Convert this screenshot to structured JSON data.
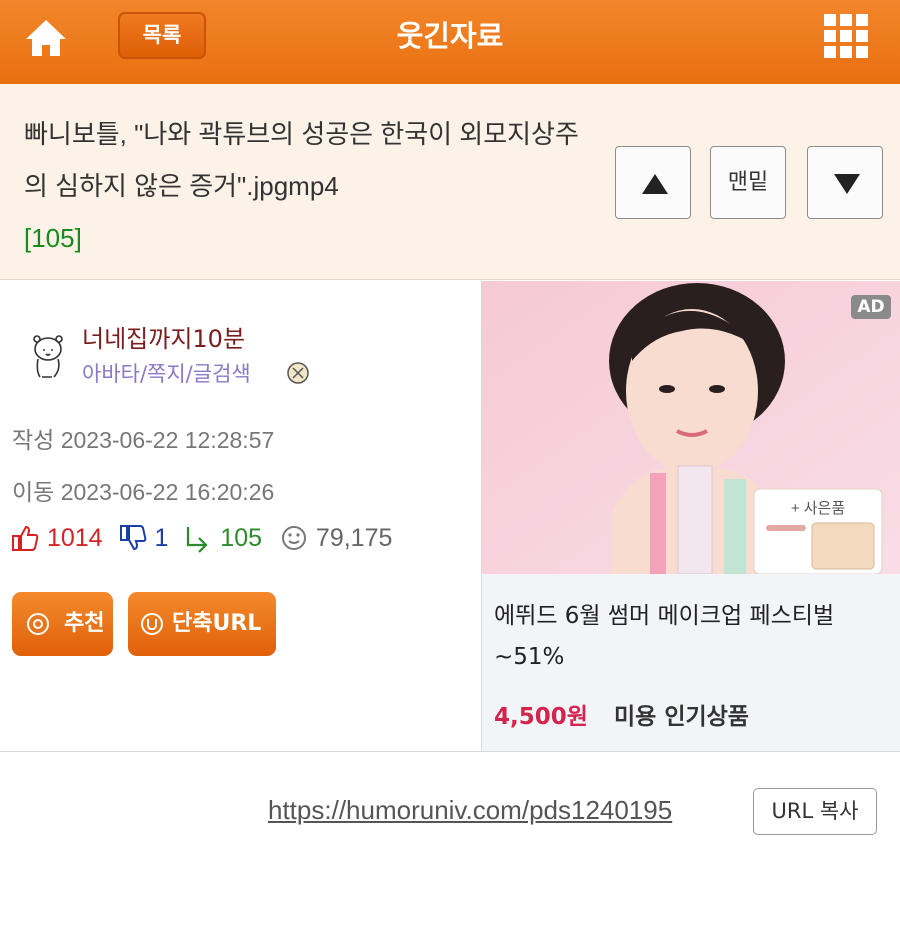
{
  "header": {
    "home_icon": "home-icon",
    "list_button": "목록",
    "title": "웃긴자료",
    "menu_icon": "grid-menu-icon",
    "bg_color": "#ee7a1b"
  },
  "post": {
    "title": "빠니보틀, \"나와 곽튜브의 성공은 한국이 외모지상주의 심하지 않은 증거\".jpgmp4",
    "comment_count": "[105]",
    "nav": {
      "up_icon": "arrow-up-icon",
      "bottom_label": "맨밑",
      "down_icon": "arrow-down-icon"
    }
  },
  "author": {
    "nickname": "너네집까지10분",
    "links": "아바타/쪽지/글검색",
    "written_label": "작성 2023-06-22 12:28:57",
    "moved_label": "이동 2023-06-22 16:20:26",
    "stats": {
      "upvotes": "1014",
      "downvotes": "1",
      "replies": "105",
      "views": "79,175"
    },
    "recommend_button": "추천",
    "shorturl_button": "단축URL"
  },
  "ad": {
    "badge": "AD",
    "gift_label": "+ 사은품",
    "title": "에뛰드 6월 썸머 메이크업 페스티벌 ~51%",
    "price": "4,500원",
    "category": "미용 인기상품"
  },
  "url": {
    "link": "https://humoruniv.com/pds1240195",
    "copy_button": "URL 복사"
  },
  "colors": {
    "accent": "#ee7a1b",
    "upvote": "#d62222",
    "downvote": "#1b3fa8",
    "reply": "#2b8a2b",
    "price": "#d3244d"
  }
}
